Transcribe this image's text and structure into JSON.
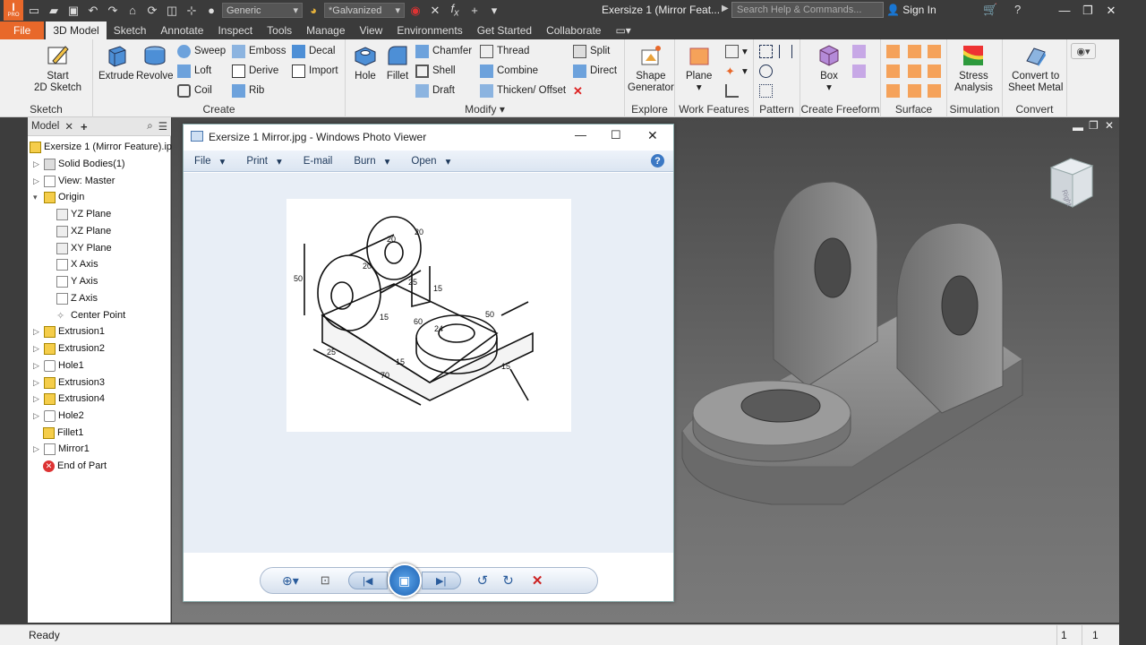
{
  "app": {
    "logo_text": "PRO",
    "document_title": "Exersize 1 (Mirror Feat...",
    "material_combo": "Generic",
    "appearance_combo": "*Galvanized",
    "help_search_placeholder": "Search Help & Commands...",
    "sign_in": "Sign In",
    "colors": {
      "file_tab": "#e8682a",
      "titlebar": "#3b3b3b",
      "ribbon": "#f0f0f0"
    }
  },
  "tabs": [
    {
      "label": "File"
    },
    {
      "label": "3D Model"
    },
    {
      "label": "Sketch"
    },
    {
      "label": "Annotate"
    },
    {
      "label": "Inspect"
    },
    {
      "label": "Tools"
    },
    {
      "label": "Manage"
    },
    {
      "label": "View"
    },
    {
      "label": "Environments"
    },
    {
      "label": "Get Started"
    },
    {
      "label": "Collaborate"
    }
  ],
  "ribbon": {
    "sketch": {
      "title": "Sketch",
      "start": "Start",
      "start2": "2D Sketch"
    },
    "create": {
      "title": "Create",
      "extrude": "Extrude",
      "revolve": "Revolve",
      "sweep": "Sweep",
      "loft": "Loft",
      "coil": "Coil",
      "emboss": "Emboss",
      "derive": "Derive",
      "rib": "Rib",
      "decal": "Decal",
      "import": "Import"
    },
    "modify": {
      "title": "Modify",
      "hole": "Hole",
      "fillet": "Fillet",
      "chamfer": "Chamfer",
      "shell": "Shell",
      "draft": "Draft",
      "thread": "Thread",
      "combine": "Combine",
      "thicken": "Thicken/ Offset",
      "split": "Split",
      "direct": "Direct"
    },
    "explore": {
      "title": "Explore",
      "shape1": "Shape",
      "shape2": "Generator"
    },
    "work_features": {
      "title": "Work Features",
      "plane": "Plane"
    },
    "pattern": {
      "title": "Pattern"
    },
    "freeform": {
      "title": "Create Freeform",
      "box": "Box"
    },
    "surface": {
      "title": "Surface"
    },
    "simulation": {
      "title": "Simulation",
      "stress1": "Stress",
      "stress2": "Analysis"
    },
    "convert": {
      "title": "Convert",
      "c1": "Convert to",
      "c2": "Sheet Metal"
    }
  },
  "browser": {
    "tab_label": "Model",
    "items": [
      {
        "label": "Exersize 1 (Mirror Feature).ipt"
      },
      {
        "label": "Solid Bodies(1)"
      },
      {
        "label": "View: Master"
      },
      {
        "label": "Origin"
      },
      {
        "label": "YZ Plane"
      },
      {
        "label": "XZ Plane"
      },
      {
        "label": "XY Plane"
      },
      {
        "label": "X Axis"
      },
      {
        "label": "Y Axis"
      },
      {
        "label": "Z Axis"
      },
      {
        "label": "Center Point"
      },
      {
        "label": "Extrusion1"
      },
      {
        "label": "Extrusion2"
      },
      {
        "label": "Hole1"
      },
      {
        "label": "Extrusion3"
      },
      {
        "label": "Extrusion4"
      },
      {
        "label": "Hole2"
      },
      {
        "label": "Fillet1"
      },
      {
        "label": "Mirror1"
      },
      {
        "label": "End of Part"
      }
    ]
  },
  "photo_viewer": {
    "title": "Exersize 1 Mirror.jpg - Windows Photo Viewer",
    "menu": [
      {
        "label": "File"
      },
      {
        "label": "Print"
      },
      {
        "label": "E-mail"
      },
      {
        "label": "Burn"
      },
      {
        "label": "Open"
      }
    ],
    "drawing_dims": [
      "50",
      "20",
      "20",
      "20",
      "25",
      "15",
      "15",
      "60",
      "24",
      "50",
      "25",
      "70",
      "15",
      "15"
    ]
  },
  "viewcube": {
    "face_label": "Right"
  },
  "status": {
    "text": "Ready",
    "count1": "1",
    "count2": "1"
  }
}
